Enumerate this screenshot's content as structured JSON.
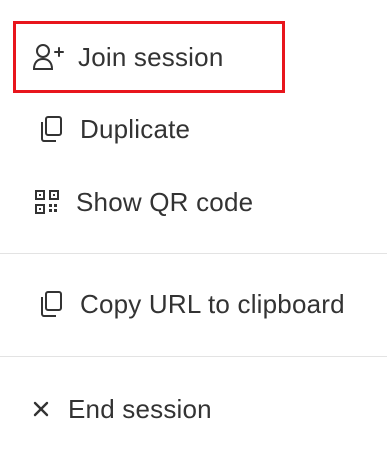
{
  "menu": {
    "items": [
      {
        "id": "join",
        "label": "Join session",
        "icon": "user-plus-icon"
      },
      {
        "id": "duplicate",
        "label": "Duplicate",
        "icon": "duplicate-icon"
      },
      {
        "id": "qr",
        "label": "Show QR code",
        "icon": "qr-code-icon"
      },
      {
        "id": "copy-url",
        "label": "Copy URL to clipboard",
        "icon": "copy-icon"
      },
      {
        "id": "end",
        "label": "End session",
        "icon": "close-icon"
      }
    ]
  },
  "colors": {
    "text": "#333333",
    "highlight_border": "#e8151c",
    "divider": "#e3e3e3",
    "background": "#ffffff"
  }
}
